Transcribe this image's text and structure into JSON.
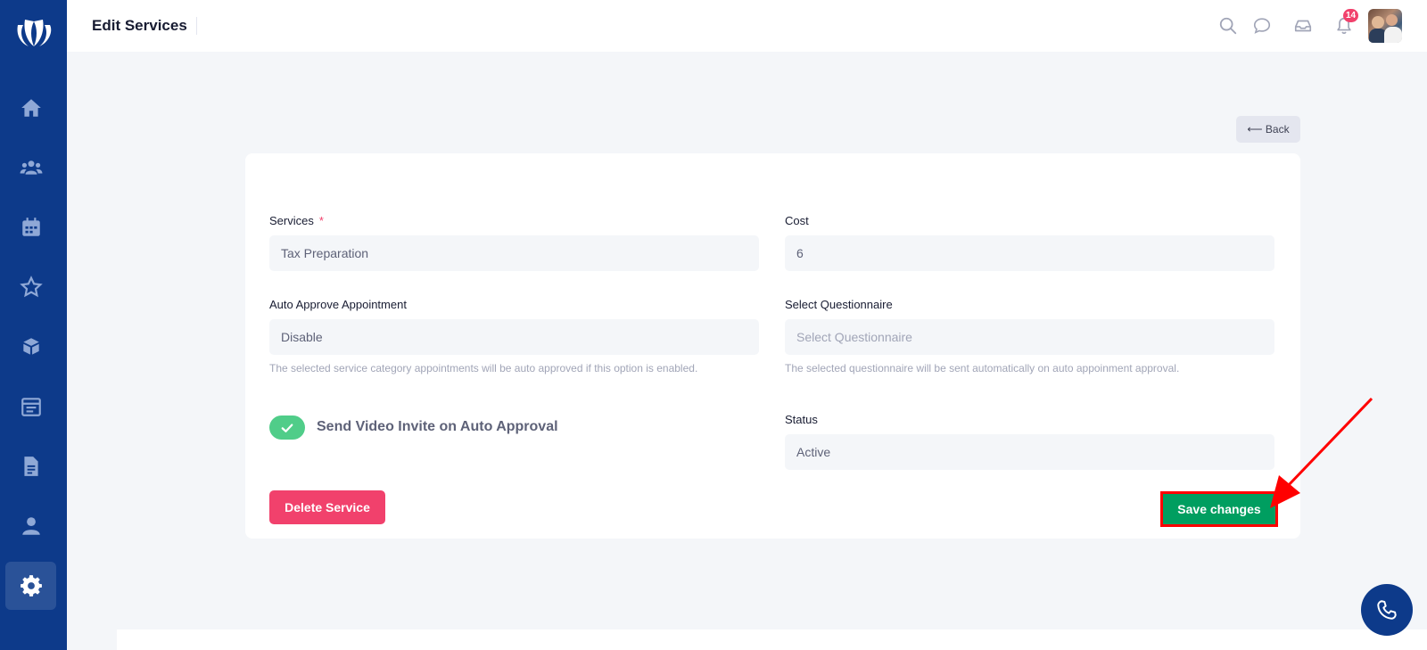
{
  "header": {
    "title": "Edit Services",
    "notification_count": "14"
  },
  "sidebar": {
    "items": [
      {
        "icon": "home-icon"
      },
      {
        "icon": "users-icon"
      },
      {
        "icon": "calendar-icon"
      },
      {
        "icon": "star-icon"
      },
      {
        "icon": "box-icon"
      },
      {
        "icon": "schedule-icon"
      },
      {
        "icon": "document-icon"
      },
      {
        "icon": "user-icon"
      },
      {
        "icon": "gear-icon",
        "active": true
      }
    ]
  },
  "back_label": "⟵ Back",
  "form": {
    "services_label": "Services",
    "required_mark": "*",
    "services_value": "Tax Preparation",
    "cost_label": "Cost",
    "cost_value": "6",
    "auto_approve_label": "Auto Approve Appointment",
    "auto_approve_value": "Disable",
    "auto_approve_hint": "The selected service category appointments will be auto approved if this option is enabled.",
    "questionnaire_label": "Select Questionnaire",
    "questionnaire_placeholder": "Select Questionnaire",
    "questionnaire_hint": "The selected questionnaire will be sent automatically on auto appoinment approval.",
    "video_invite_label": "Send Video Invite on Auto Approval",
    "video_invite_enabled": true,
    "status_label": "Status",
    "status_value": "Active",
    "delete_label": "Delete Service",
    "save_label": "Save changes"
  },
  "colors": {
    "sidebar": "#0d3a8a",
    "save": "#009e60",
    "delete": "#f1416c",
    "toggle": "#50cd89",
    "highlight": "#ff0000"
  }
}
